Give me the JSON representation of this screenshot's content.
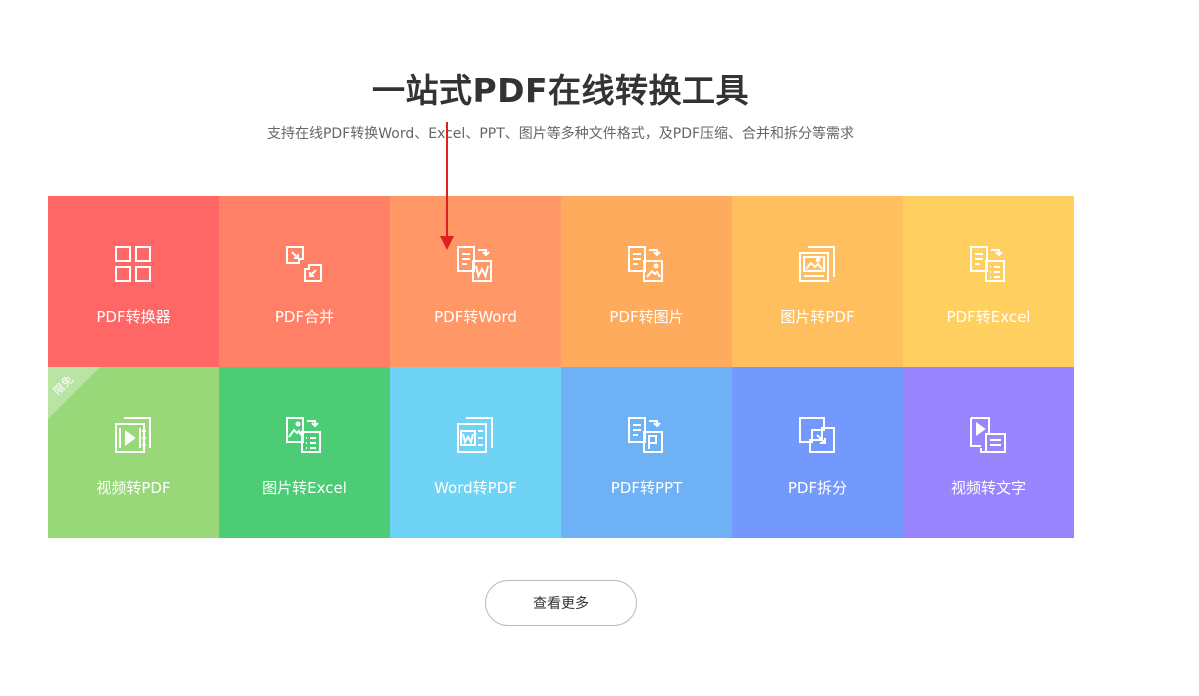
{
  "hero": {
    "title": "一站式PDF在线转换工具",
    "subtitle": "支持在线PDF转换Word、Excel、PPT、图片等多种文件格式，及PDF压缩、合并和拆分等需求"
  },
  "tools": [
    {
      "label": "PDF转换器",
      "icon": "grid-icon",
      "color": "#ff6767"
    },
    {
      "label": "PDF合并",
      "icon": "merge-icon",
      "color": "#ff8066"
    },
    {
      "label": "PDF转Word",
      "icon": "pdf-to-word-icon",
      "color": "#ff9866"
    },
    {
      "label": "PDF转图片",
      "icon": "pdf-to-image-icon",
      "color": "#ffab5e"
    },
    {
      "label": "图片转PDF",
      "icon": "image-to-pdf-icon",
      "color": "#ffbf5e"
    },
    {
      "label": "PDF转Excel",
      "icon": "pdf-to-excel-icon",
      "color": "#ffcf5f"
    },
    {
      "label": "视频转PDF",
      "icon": "video-to-pdf-icon",
      "color": "#98d878",
      "badge": "限免"
    },
    {
      "label": "图片转Excel",
      "icon": "image-to-excel-icon",
      "color": "#4ccc74"
    },
    {
      "label": "Word转PDF",
      "icon": "word-to-pdf-icon",
      "color": "#6ed3f5"
    },
    {
      "label": "PDF转PPT",
      "icon": "pdf-to-ppt-icon",
      "color": "#6eb2f5"
    },
    {
      "label": "PDF拆分",
      "icon": "split-icon",
      "color": "#7399fd"
    },
    {
      "label": "视频转文字",
      "icon": "video-to-text-icon",
      "color": "#9985fd"
    }
  ],
  "more_button": {
    "label": "查看更多"
  },
  "colors": {
    "title": "#333333",
    "subtitle": "#666666",
    "annotation_arrow": "#e02020"
  }
}
